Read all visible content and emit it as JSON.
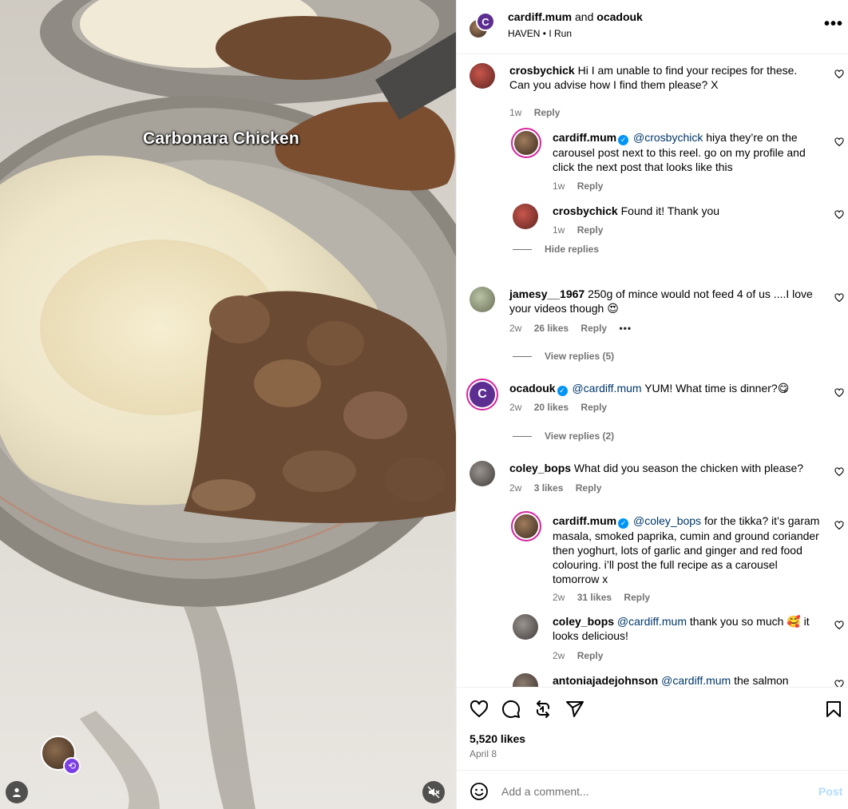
{
  "media": {
    "overlay_title": "Carbonara Chicken"
  },
  "header": {
    "author": "cardiff.mum",
    "joiner": "and",
    "collaborator": "ocadouk",
    "audio_artist": "HAVEN",
    "audio_separator": "•",
    "audio_track": "I Run",
    "more_label": "•••"
  },
  "comments": [
    {
      "user": "crosbychick",
      "text": "Hi I am unable to find your recipes for these. Can you advise how I find them please? X",
      "age": "1w",
      "reply_label": "Reply"
    },
    {
      "user": "cardiff.mum",
      "mention": "@crosbychick",
      "text": "hiya they’re on the carousel post next to this reel. go on my profile and click the next post that looks like this",
      "age": "1w",
      "reply_label": "Reply"
    },
    {
      "user": "crosbychick",
      "text": "Found it! Thank you",
      "age": "1w",
      "reply_label": "Reply"
    },
    {
      "user": "jamesy__1967",
      "text": "250g of mince would not feed 4 of us ....I love your videos though 😍",
      "age": "2w",
      "likes": "26 likes",
      "reply_label": "Reply",
      "more": "•••"
    },
    {
      "user": "ocadouk",
      "mention": "@cardiff.mum",
      "text": "YUM! What time is dinner?😋",
      "age": "2w",
      "likes": "20 likes",
      "reply_label": "Reply"
    },
    {
      "user": "coley_bops",
      "text": "What did you season the chicken with please?",
      "age": "2w",
      "likes": "3 likes",
      "reply_label": "Reply"
    },
    {
      "user": "cardiff.mum",
      "mention": "@coley_bops",
      "text": "for the tikka? it’s garam masala, smoked paprika, cumin and ground coriander then yoghurt, lots of garlic and ginger and red food colouring. i’ll post the full recipe as a carousel tomorrow x",
      "age": "2w",
      "likes": "31 likes",
      "reply_label": "Reply"
    },
    {
      "user": "coley_bops",
      "mention": "@cardiff.mum",
      "text": "thank you so much 🥰 it looks delicious!",
      "age": "2w",
      "reply_label": "Reply"
    },
    {
      "user": "antoniajadejohnson",
      "mention": "@cardiff.mum",
      "text": "the salmon"
    }
  ],
  "thread_toggles": {
    "hide_replies": "Hide replies",
    "view_replies_jamesy": "View replies (5)",
    "view_replies_ocado": "View replies (2)"
  },
  "actions": {
    "likes": "5,520 likes",
    "date": "April 8"
  },
  "composer": {
    "placeholder": "Add a comment...",
    "post_label": "Post"
  },
  "colors": {
    "link": "#00376b",
    "muted": "#737373",
    "verified": "#0095f6",
    "post_disabled": "#b3dbff"
  }
}
